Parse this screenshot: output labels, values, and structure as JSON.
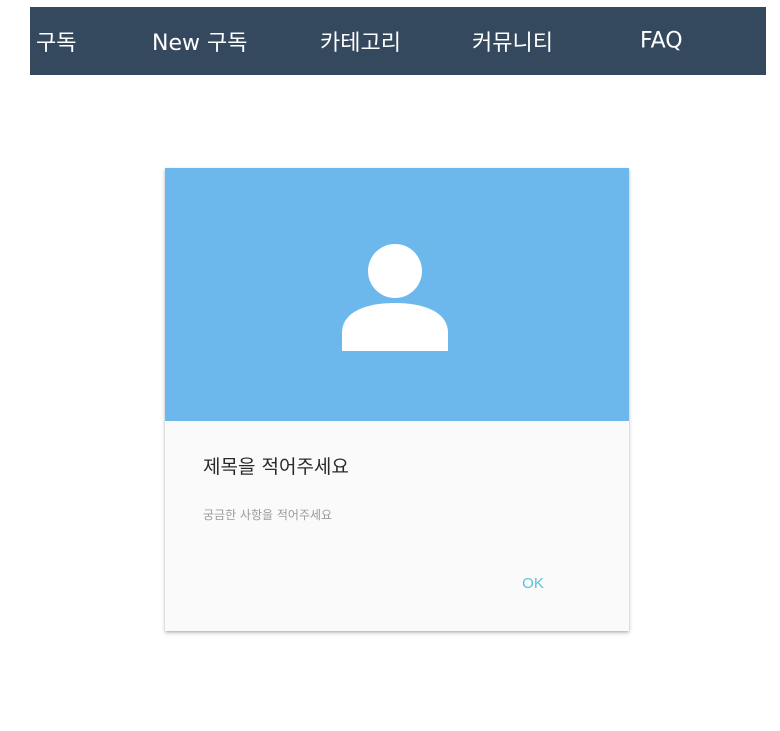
{
  "navbar": {
    "items": [
      {
        "label": "구독"
      },
      {
        "label": "New 구독"
      },
      {
        "label": "카테고리"
      },
      {
        "label": "커뮤니티"
      },
      {
        "label": "FAQ"
      }
    ],
    "background": "#34495e"
  },
  "card": {
    "media_icon": "user-icon",
    "media_color": "#6cb8ec",
    "title": "제목을 적어주세요",
    "text": "궁금한 사항을 적어주세요",
    "ok_label": "OK",
    "ok_color": "#55c5d6"
  }
}
